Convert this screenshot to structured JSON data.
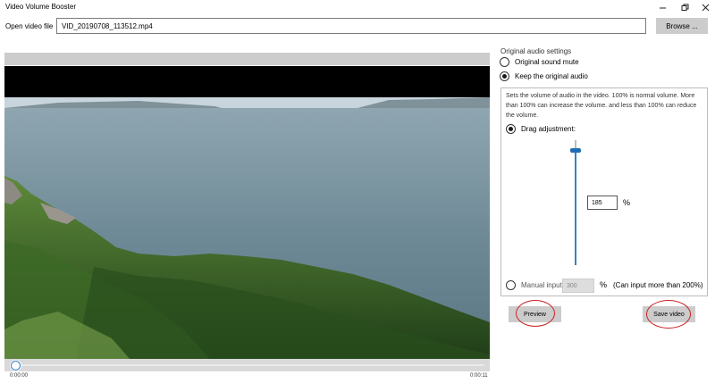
{
  "window": {
    "title": "Video Volume Booster",
    "minimize_icon": "minimize-icon",
    "maximize_icon": "restore-icon",
    "close_icon": "close-icon"
  },
  "file": {
    "label": "Open video file",
    "value": "VID_20190708_113512.mp4",
    "browse_label": "Browse ..."
  },
  "player": {
    "time_start": "0:00:00",
    "time_end": "0:00:11",
    "position_fraction": 0.0
  },
  "audio": {
    "section_title": "Original audio settings",
    "options": [
      {
        "label": "Original sound mute",
        "checked": false
      },
      {
        "label": "Keep the original audio",
        "checked": true
      }
    ],
    "description": "Sets the volume of audio in the video. 100% is normal volume. More than 100% can increase the volume. and less than 100% can reduce the volume.",
    "drag_label": "Drag adjustment:",
    "drag_value": "185",
    "percent_sign": "%",
    "manual_label": "Manual input:",
    "manual_value": "300",
    "manual_note": "(Can input more than 200%)"
  },
  "actions": {
    "preview_label": "Preview",
    "save_label": "Save video"
  },
  "colors": {
    "accent": "#3a7fc4",
    "highlight_circle": "#c22222",
    "button_gray": "#cccccc"
  }
}
